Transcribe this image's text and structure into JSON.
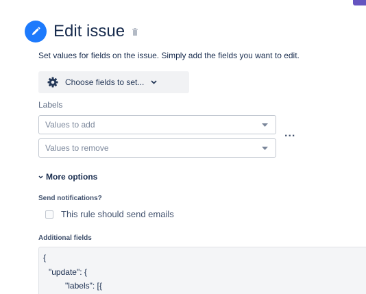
{
  "header": {
    "title": "Edit issue",
    "icon": "pencil-icon",
    "delete_icon": "trash-icon",
    "accent_color": "#1d7afc"
  },
  "description": "Set values for fields on the issue. Simply add the fields you want to edit.",
  "choose_fields": {
    "label": "Choose fields to set...",
    "icon": "gear-icon"
  },
  "labels_field": {
    "caption": "Labels",
    "add_placeholder": "Values to add",
    "remove_placeholder": "Values to remove",
    "more_label": "..."
  },
  "more_options": {
    "label": "More options"
  },
  "notifications": {
    "caption": "Send notifications?",
    "checkbox_label": "This rule should send emails",
    "checked": false
  },
  "additional_fields": {
    "caption": "Additional fields",
    "lines": [
      "{",
      "\"update\": {",
      "\"labels\": [{"
    ]
  }
}
